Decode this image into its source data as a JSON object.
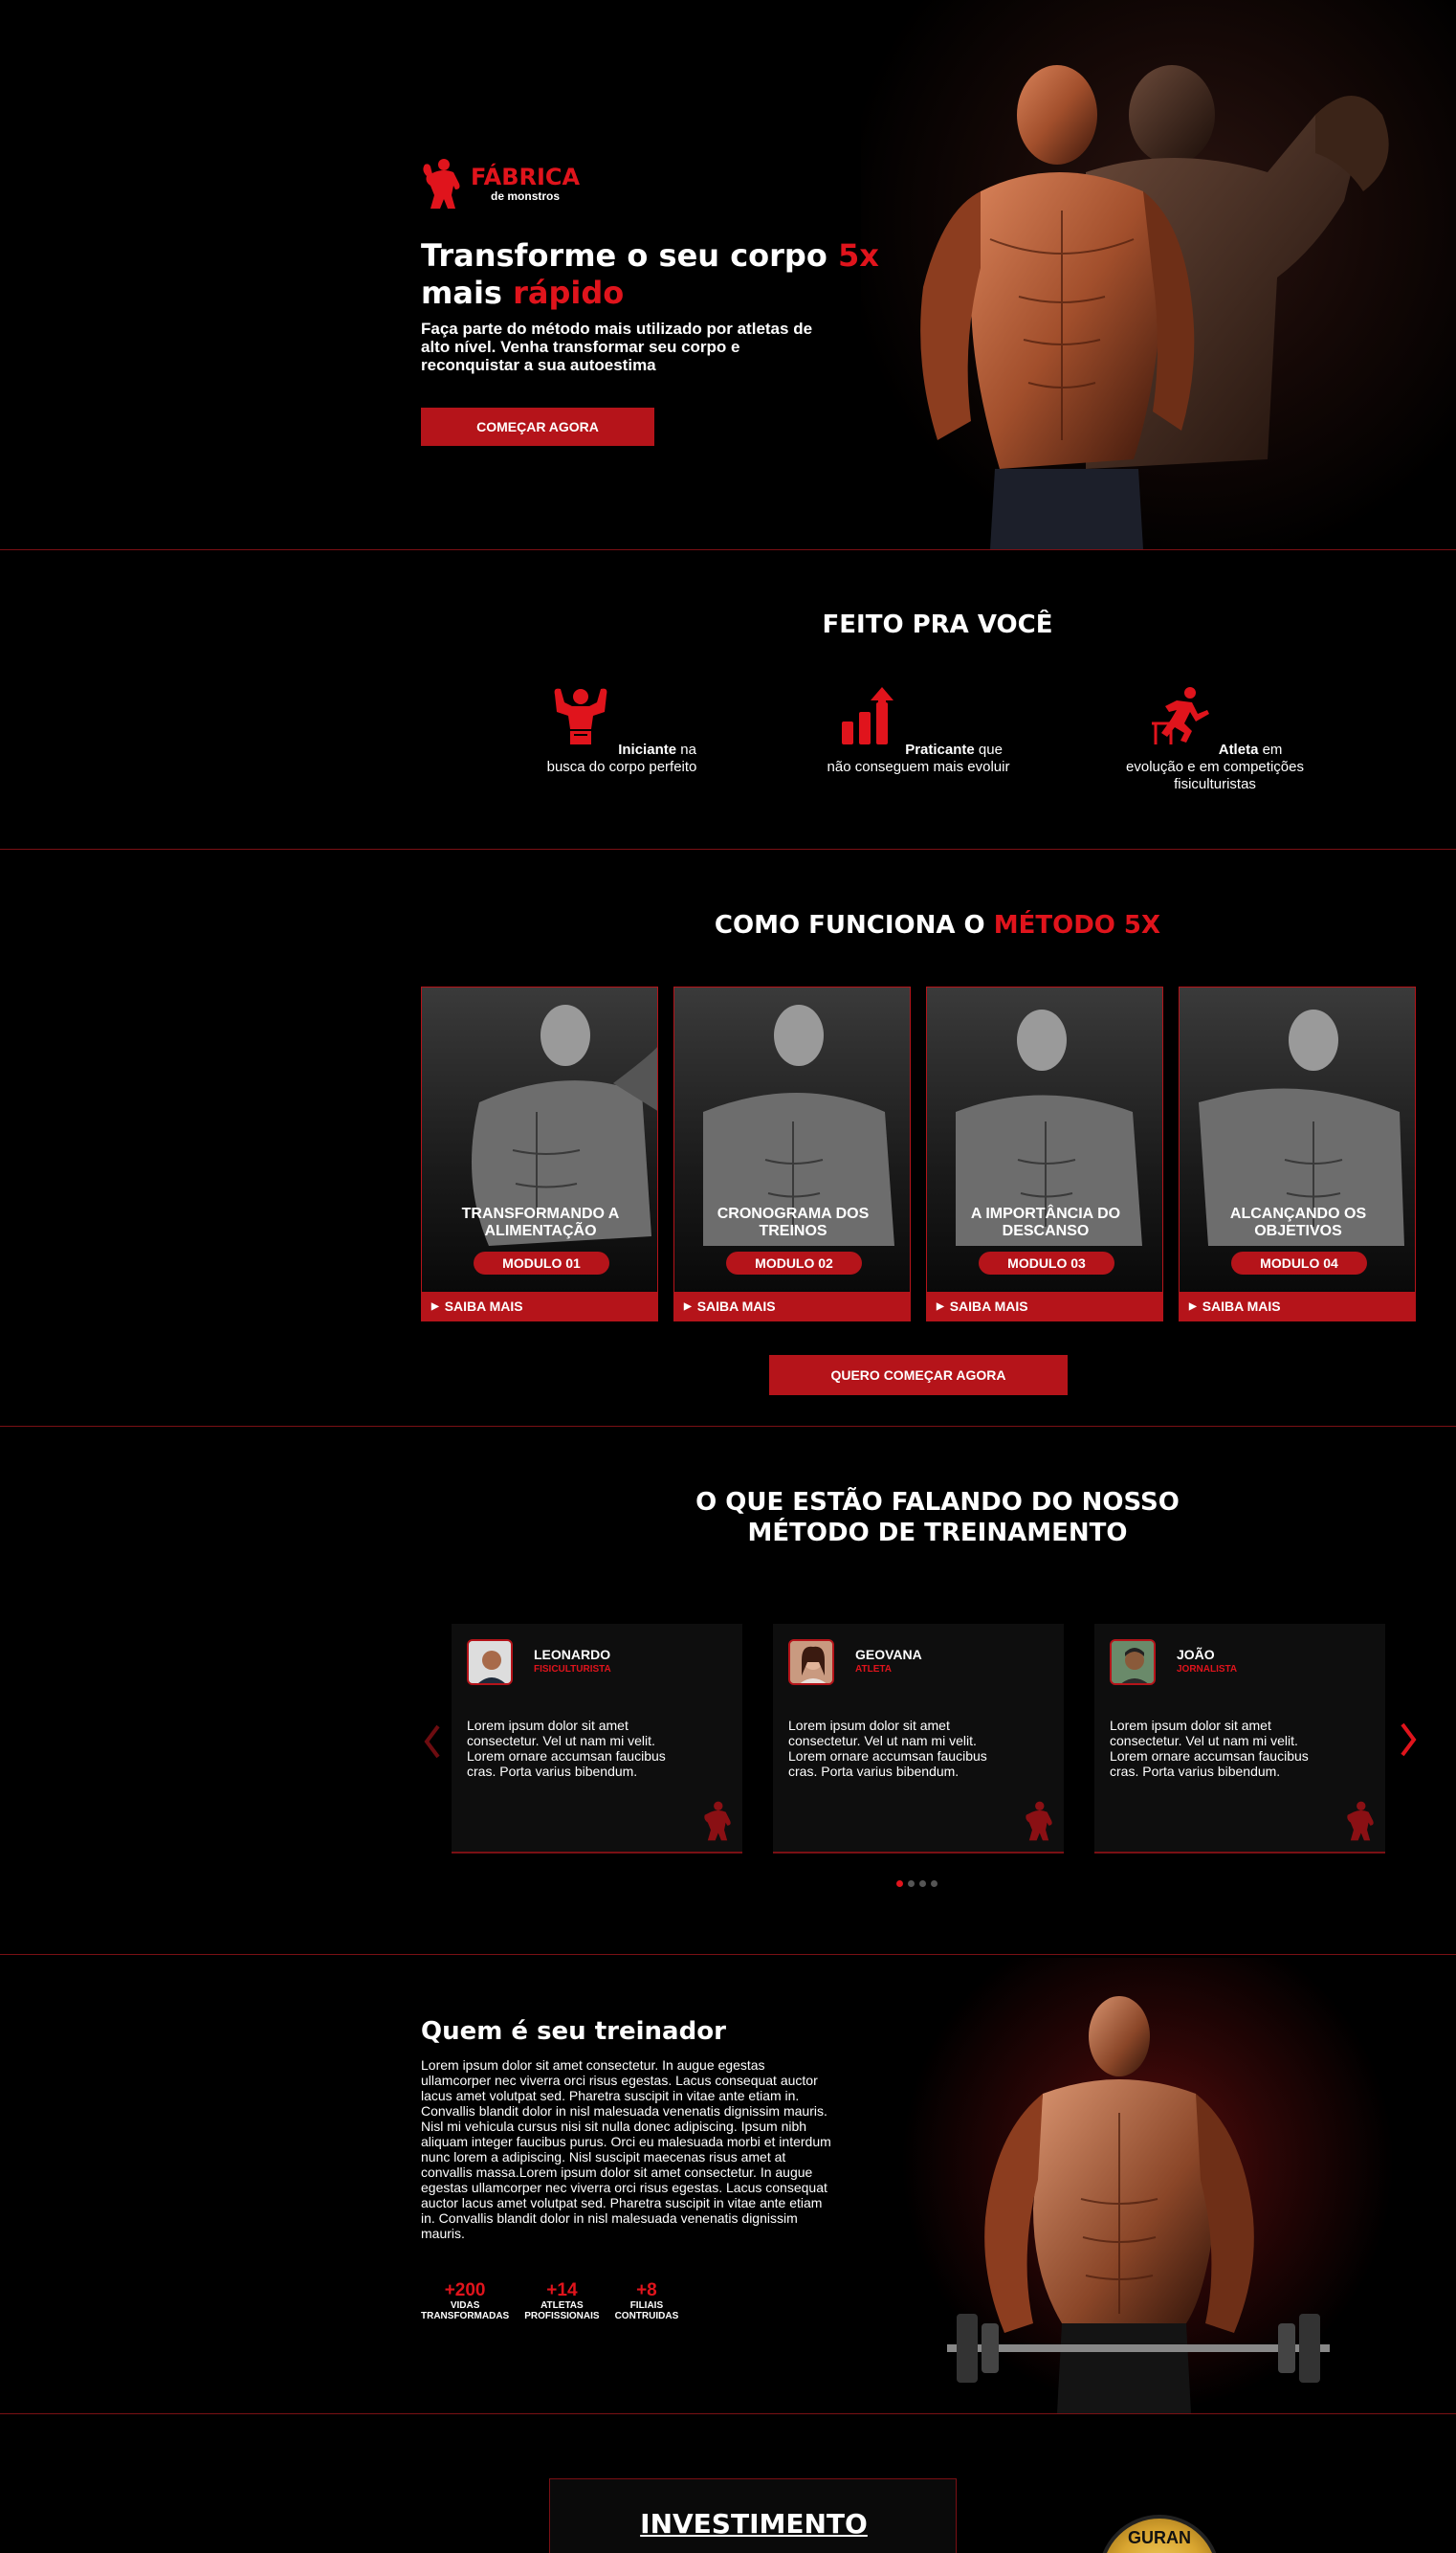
{
  "colors": {
    "accent": "#e0141c",
    "button": "#b5141a",
    "background": "#000000",
    "divider": "#7a1014"
  },
  "brand": {
    "name": "FÁBRICA",
    "tagline": "de monstros"
  },
  "hero": {
    "title_part1": "Transforme o seu corpo ",
    "title_hl1": "5x",
    "title_part2": " mais ",
    "title_hl2": "rápido",
    "description": "Faça parte do método mais utilizado por atletas de alto nível. Venha transformar seu corpo e reconquistar a sua autoestima",
    "cta": "COMEÇAR AGORA"
  },
  "for_you": {
    "title": "FEITO PRA VOCÊ",
    "items": [
      {
        "bold": "Iniciante",
        "text": " na busca do corpo perfeito",
        "icon": "muscle-man-icon"
      },
      {
        "bold": "Praticante",
        "text": " que não conseguem mais evoluir",
        "icon": "growth-chart-icon"
      },
      {
        "bold": "Atleta",
        "text": " em evolução e em competições fisiculturistas",
        "icon": "hurdle-runner-icon"
      }
    ]
  },
  "method": {
    "title_part1": "COMO FUNCIONA O ",
    "title_hl": "MÉTODO 5X",
    "modules": [
      {
        "title": "TRANSFORMANDO A ALIMENTAÇÃO",
        "badge": "MODULO 01",
        "link": "SAIBA MAIS"
      },
      {
        "title": "CRONOGRAMA DOS TREINOS",
        "badge": "MODULO 02",
        "link": "SAIBA MAIS"
      },
      {
        "title": "A IMPORTÂNCIA DO DESCANSO",
        "badge": "MODULO 03",
        "link": "SAIBA MAIS"
      },
      {
        "title": "ALCANÇANDO OS OBJETIVOS",
        "badge": "MODULO 04",
        "link": "SAIBA MAIS"
      }
    ],
    "cta": "QUERO COMEÇAR AGORA"
  },
  "testimonials": {
    "title_line1": "O QUE ESTÃO FALANDO DO NOSSO",
    "title_line2": "MÉTODO DE TREINAMENTO",
    "items": [
      {
        "name": "LEONARDO",
        "role": "FISICULTURISTA",
        "text": "Lorem ipsum dolor sit amet consectetur. Vel ut nam mi velit. Lorem ornare accumsan faucibus cras. Porta varius bibendum."
      },
      {
        "name": "GEOVANA",
        "role": "ATLETA",
        "text": "Lorem ipsum dolor sit amet consectetur. Vel ut nam mi velit. Lorem ornare accumsan faucibus cras. Porta varius bibendum."
      },
      {
        "name": "JOÃO",
        "role": "JORNALISTA",
        "text": "Lorem ipsum dolor sit amet consectetur. Vel ut nam mi velit. Lorem ornare accumsan faucibus cras. Porta varius bibendum."
      }
    ],
    "slides_total": 4,
    "active_slide": 1
  },
  "trainer": {
    "title": "Quem é seu treinador",
    "text": "Lorem ipsum dolor sit amet consectetur. In augue egestas ullamcorper nec viverra orci risus egestas. Lacus consequat auctor lacus amet volutpat sed. Pharetra suscipit in vitae ante etiam in. Convallis blandit dolor in nisl malesuada venenatis dignissim mauris. Nisl mi vehicula cursus nisi sit nulla donec adipiscing. Ipsum nibh aliquam integer faucibus purus. Orci eu malesuada morbi et interdum nunc lorem a adipiscing. Nisl suscipit maecenas risus amet at convallis massa.Lorem ipsum dolor sit amet consectetur. In augue egestas ullamcorper nec viverra orci risus egestas. Lacus consequat auctor lacus amet volutpat sed. Pharetra suscipit in vitae ante etiam in. Convallis blandit dolor in nisl malesuada venenatis dignissim mauris.",
    "stats": [
      {
        "num": "+200",
        "label1": "VIDAS",
        "label2": "TRANSFORMADAS"
      },
      {
        "num": "+14",
        "label1": "ATLETAS",
        "label2": "PROFISSIONAIS"
      },
      {
        "num": "+8",
        "label1": "FILIAIS",
        "label2": "CONTRUIDAS"
      }
    ]
  },
  "investment": {
    "title": "INVESTIMENTO",
    "seal_text": "GURAN"
  }
}
